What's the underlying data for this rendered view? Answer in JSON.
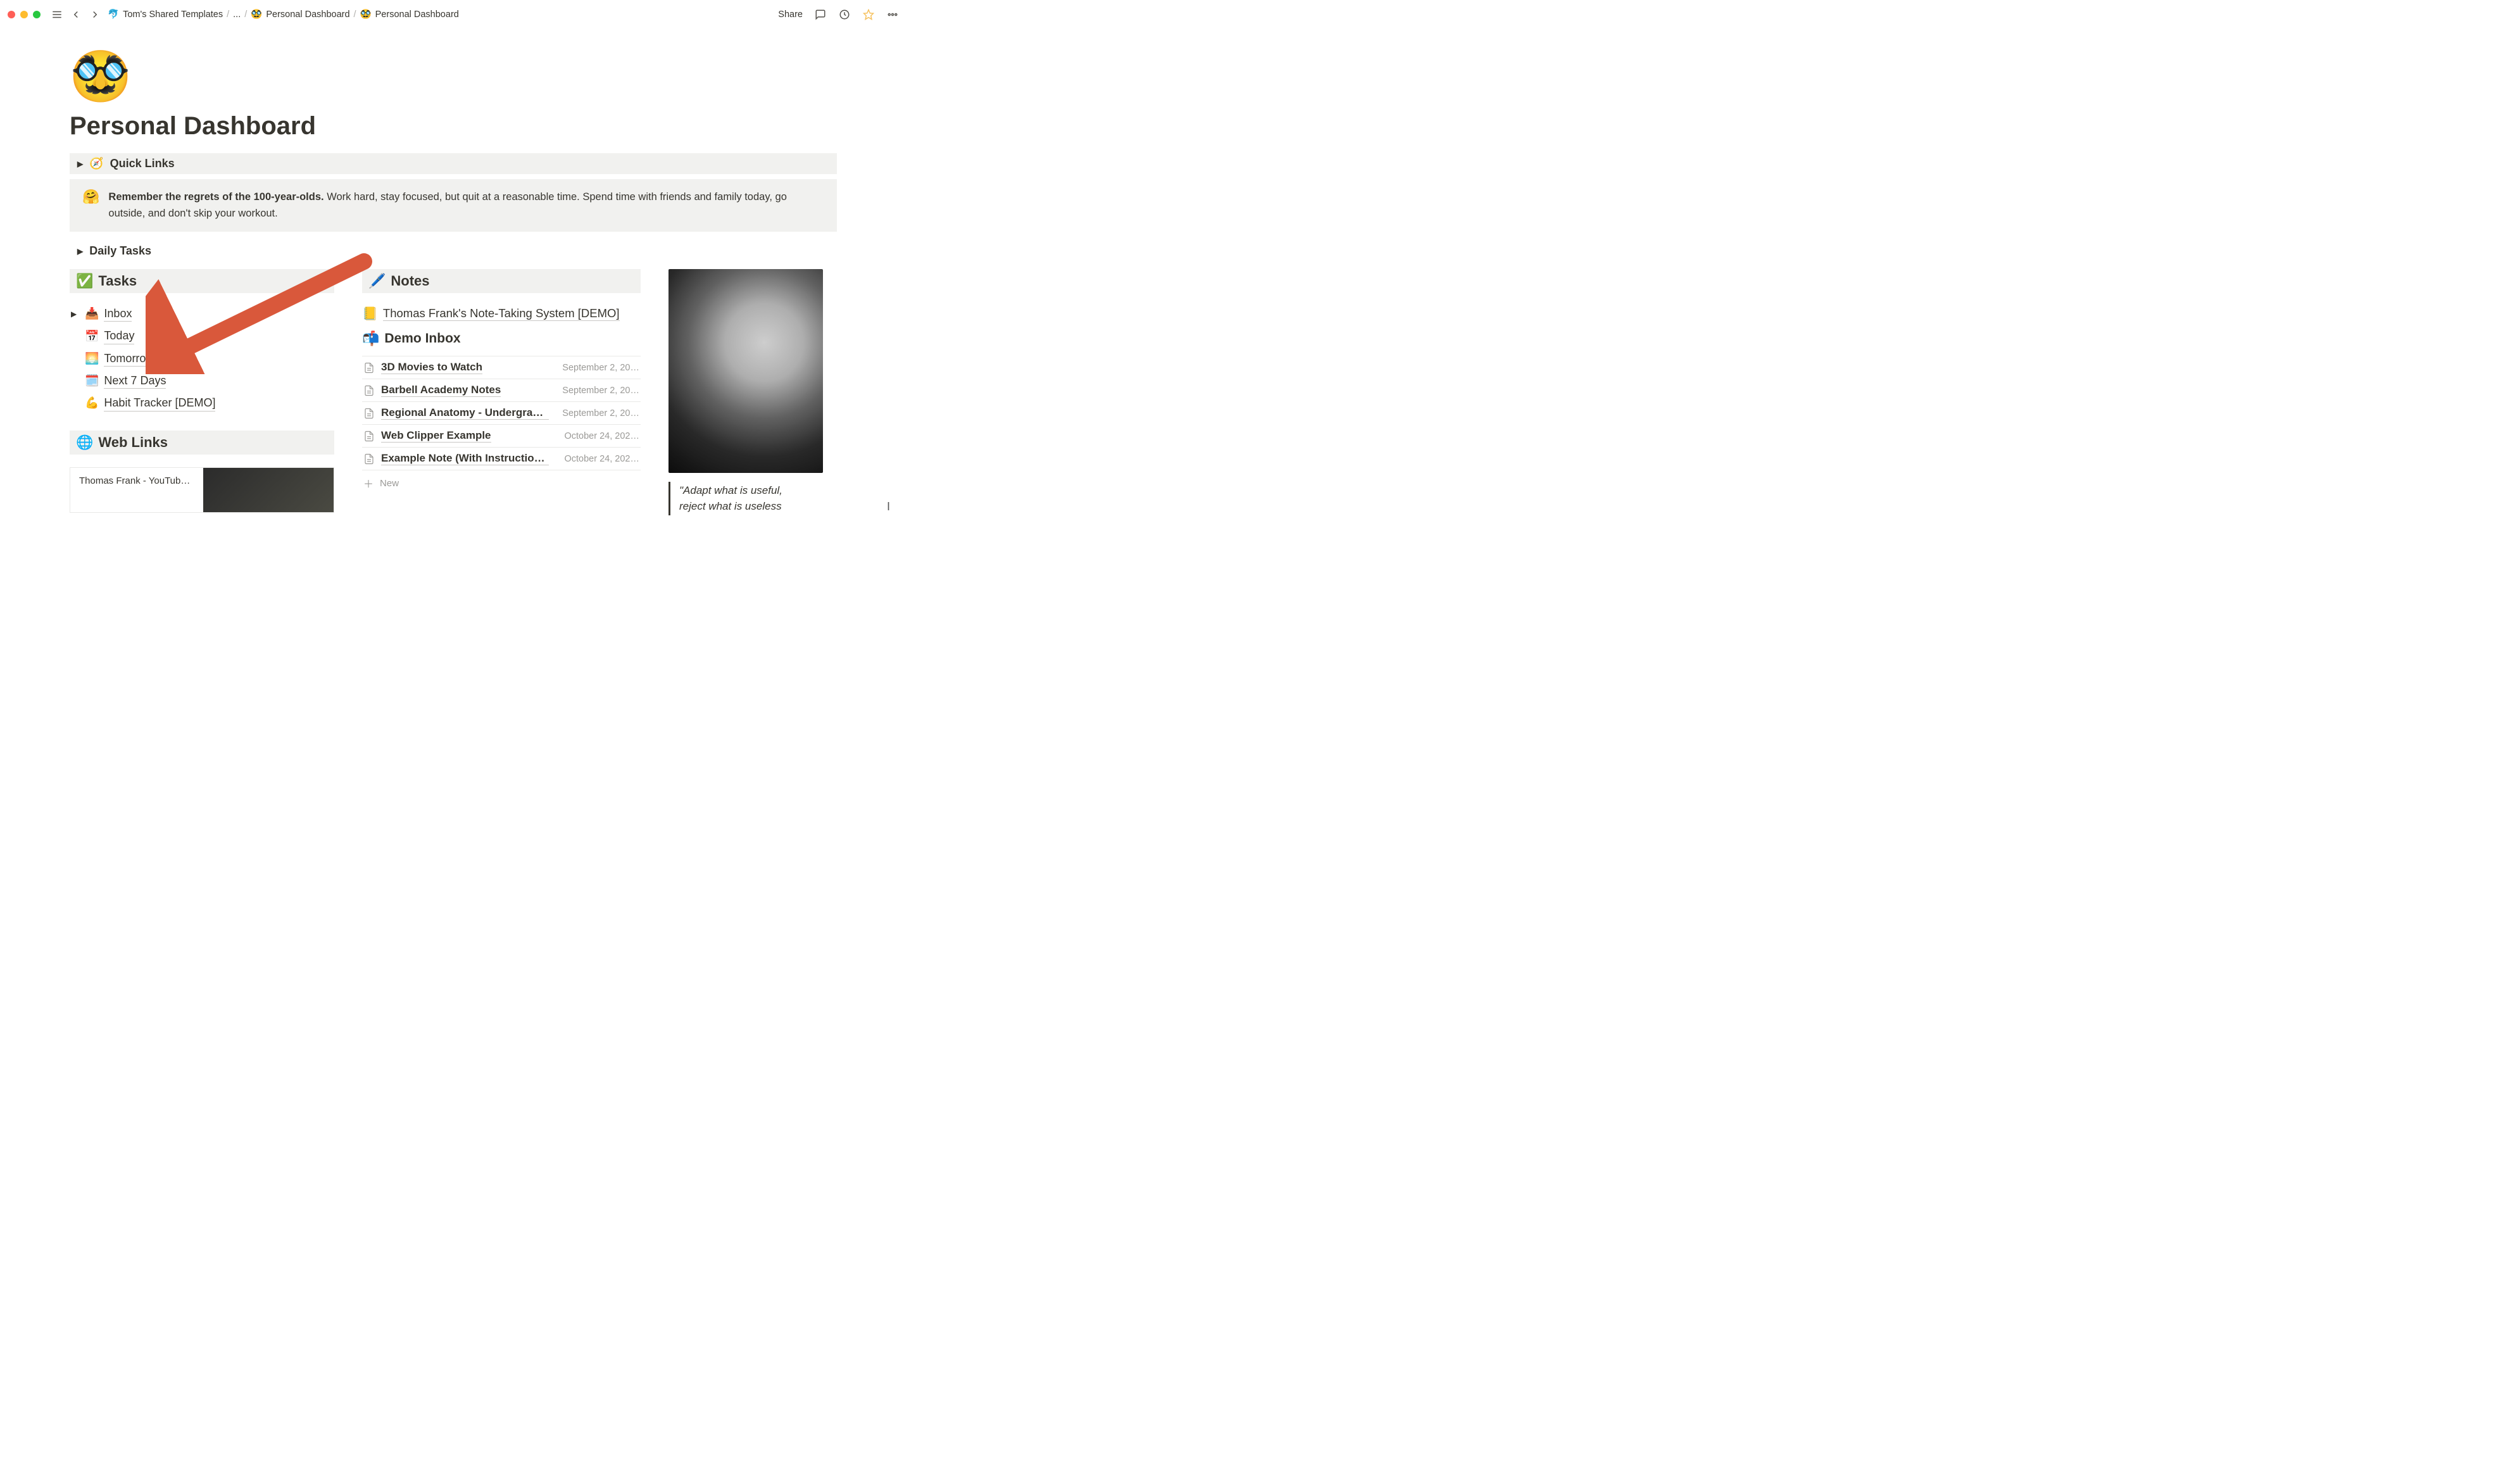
{
  "window": {
    "traffic": [
      "red",
      "yellow",
      "green"
    ]
  },
  "breadcrumb": {
    "workspace_icon": "🐬",
    "workspace": "Tom's Shared Templates",
    "ellipsis": "...",
    "parent_icon": "🥸",
    "parent": "Personal Dashboard",
    "current_icon": "🥸",
    "current": "Personal Dashboard"
  },
  "topbar": {
    "share": "Share"
  },
  "page": {
    "icon": "🥸",
    "title": "Personal Dashboard"
  },
  "quick_links": {
    "caret": "▶",
    "icon": "🧭",
    "label": "Quick Links"
  },
  "callout": {
    "icon": "🤗",
    "bold": "Remember the regrets of the 100-year-olds.",
    "rest": " Work hard, stay focused, but quit at a reasonable time. Spend time with friends and family today, go outside, and don't skip your workout."
  },
  "daily_tasks": {
    "caret": "▶",
    "label": "Daily Tasks"
  },
  "tasks": {
    "icon": "✅",
    "header": "Tasks",
    "items": [
      {
        "caret": "▶",
        "icon": "📥",
        "label": "Inbox"
      },
      {
        "caret": "",
        "icon": "📅",
        "label": "Today"
      },
      {
        "caret": "",
        "icon": "🌅",
        "label": "Tomorrow"
      },
      {
        "caret": "",
        "icon": "🗓️",
        "label": "Next 7 Days"
      },
      {
        "caret": "",
        "icon": "💪",
        "label": "Habit Tracker [DEMO]"
      }
    ]
  },
  "weblinks": {
    "icon": "🌐",
    "header": "Web Links",
    "card_title": "Thomas Frank - YouTub…"
  },
  "notes": {
    "icon": "🖊️",
    "header": "Notes",
    "pin_icon": "📒",
    "pin_label": "Thomas Frank's Note-Taking System [DEMO]",
    "inbox_icon": "📬",
    "inbox_label": "Demo Inbox",
    "rows": [
      {
        "title": "3D Movies to Watch",
        "date": "September 2, 20…"
      },
      {
        "title": "Barbell Academy Notes",
        "date": "September 2, 20…"
      },
      {
        "title": "Regional Anatomy - Undergrad…",
        "date": "September 2, 20…"
      },
      {
        "title": "Web Clipper Example",
        "date": "October 24, 202…"
      },
      {
        "title": "Example Note (With Instruction…",
        "date": "October 24, 202…"
      }
    ],
    "new_label": "New"
  },
  "quote": {
    "line1": "\"Adapt what is useful,",
    "line2": "reject what is useless"
  },
  "annotation": {
    "arrow_color": "#d9583b"
  }
}
